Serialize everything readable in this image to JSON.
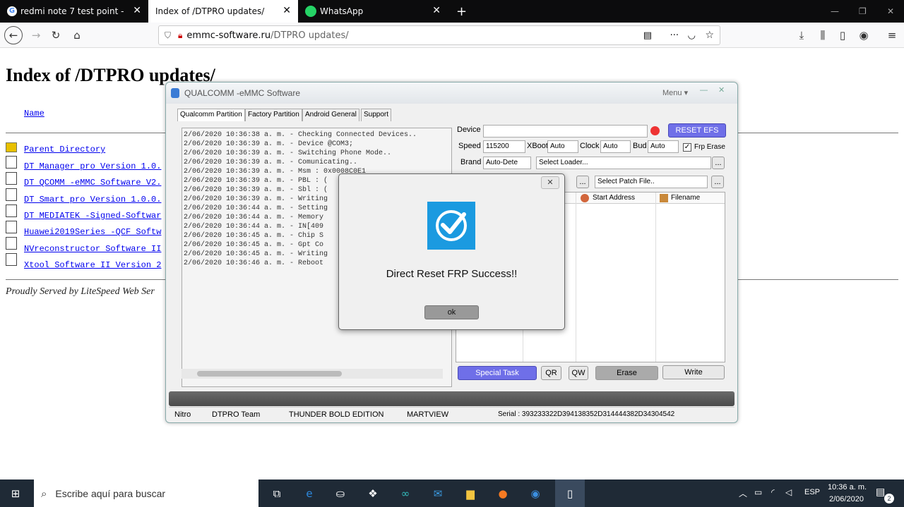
{
  "browser": {
    "tabs": [
      {
        "label": "redmi note 7 test point - Búsqu",
        "close": "✕"
      },
      {
        "label": "Index of /DTPRO updates/",
        "close": "✕"
      },
      {
        "label": "WhatsApp",
        "close": "✕"
      }
    ],
    "new_tab": "+",
    "url_domain": "emmc-software.ru",
    "url_path": "/DTPRO updates/"
  },
  "page": {
    "title": "Index of /DTPRO updates/",
    "name_header": "Name",
    "entries": [
      "Parent Directory",
      "DT Manager pro Version 1.0.",
      "DT QCOMM -eMMC Software V2.",
      "DT Smart pro Version 1.0.0.",
      "DT MEDIATEK -Signed-Softwar",
      "Huawei2019Series -QCF Softw",
      "NVreconstructor Software II",
      "Xtool Software II Version 2"
    ],
    "footer": "Proudly Served by LiteSpeed Web Ser"
  },
  "app": {
    "title": "QUALCOMM -eMMC Software",
    "menu": "Menu ▾",
    "tabs": [
      "Qualcomm Partition",
      "Factory Partition",
      "Android General",
      "Support"
    ],
    "log": [
      "2/06/2020 10:36:38 a. m. - Checking Connected Devices..",
      "2/06/2020 10:36:39 a. m. - Device @COM3;",
      "2/06/2020 10:36:39 a. m. - Switching Phone Mode..",
      "2/06/2020 10:36:39 a. m. - Comunicating..",
      "2/06/2020 10:36:39 a. m. - Msm : 0x0008C0E1",
      "2/06/2020 10:36:39 a. m. - PBL : (",
      "2/06/2020 10:36:39 a. m. - Sbl : (",
      "2/06/2020 10:36:39 a. m. - Writing",
      "2/06/2020 10:36:44 a. m. - Setting",
      "2/06/2020 10:36:44 a. m. - Memory",
      "2/06/2020 10:36:44 a. m. - IN[409",
      "2/06/2020 10:36:45 a. m. - Chip S",
      "2/06/2020 10:36:45 a. m. - Gpt Co",
      "2/06/2020 10:36:45 a. m. - Writing",
      "2/06/2020 10:36:46 a. m. - Reboot"
    ],
    "device_label": "Device",
    "device_value": "",
    "reset_efs": "RESET EFS",
    "speed_label": "Speed",
    "speed_value": "115200",
    "xboot_label": "XBoot",
    "xboot_value": "Auto",
    "clock_label": "Clock",
    "clock_value": "Auto",
    "bud_label": "Bud",
    "bud_value": "Auto",
    "frp_erase_label": "Frp Erase",
    "frp_erase_checked": true,
    "brand_label": "Brand",
    "brand_value": "Auto-Dete",
    "select_loader": "Select Loader...",
    "select_patch": "Select Patch File..",
    "browse": "...",
    "col_start": "Start Address",
    "col_filename": "Filename",
    "special_task": "Special Task",
    "qr": "QR",
    "qw": "QW",
    "erase": "Erase",
    "write": "Write",
    "status": {
      "nitro": "Nitro",
      "team": "DTPRO Team",
      "edition": "THUNDER BOLD EDITION",
      "martview": "MARTVIEW",
      "serial": "Serial : 393233322D394138352D314444382D34304542"
    }
  },
  "dialog": {
    "close": "✕",
    "message": "Direct Reset FRP Success!!",
    "ok": "ok"
  },
  "taskbar": {
    "search_placeholder": "Escribe aquí para buscar",
    "lang": "ESP",
    "time": "10:36 a. m.",
    "date": "2/06/2020",
    "notif_count": "2"
  },
  "colors": {
    "accent": "#1b9ae0",
    "purple": "#6f6fe8"
  }
}
